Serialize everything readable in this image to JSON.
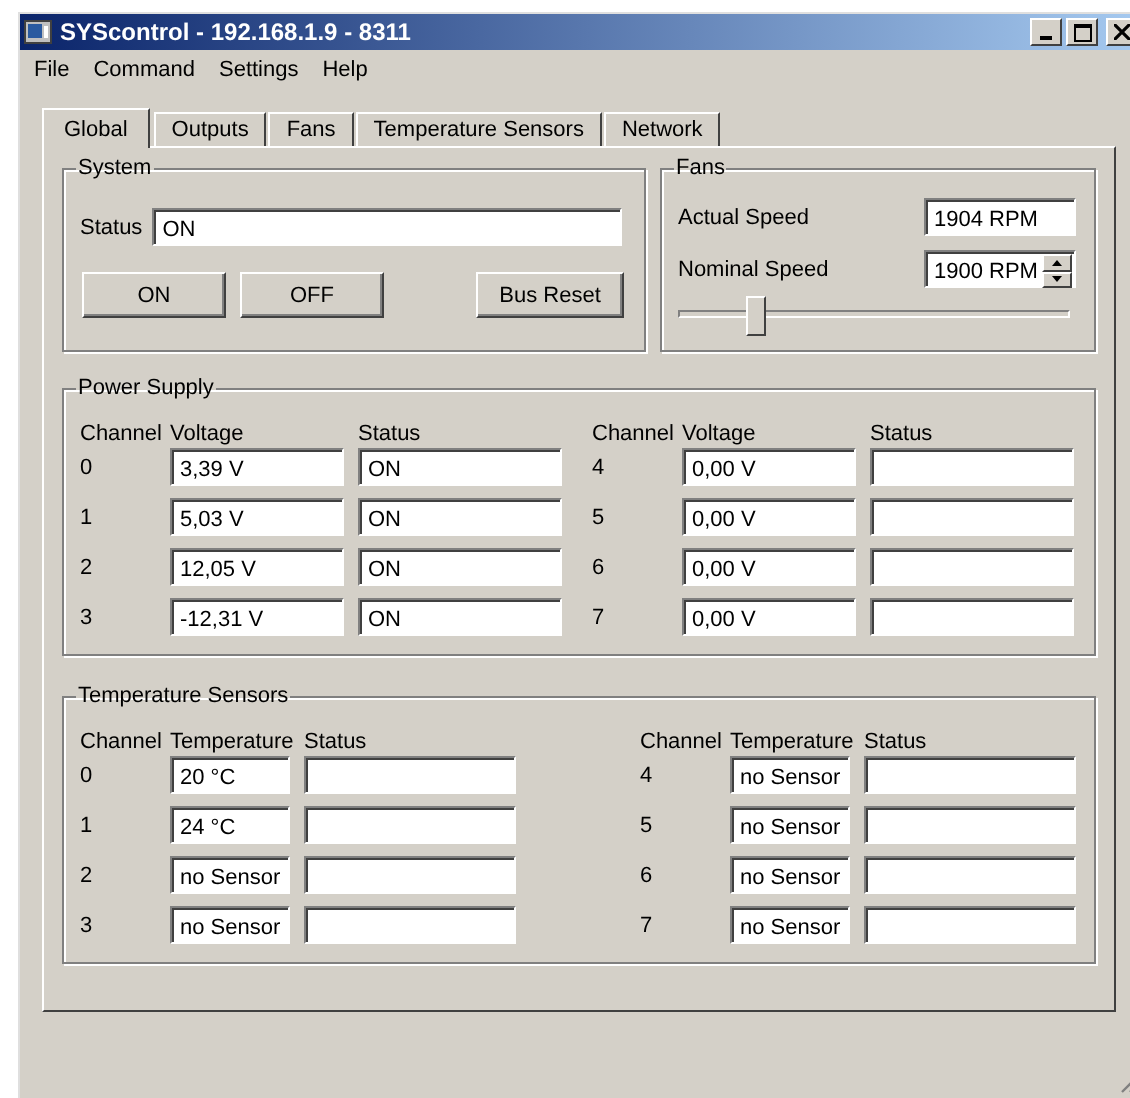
{
  "window": {
    "title": "SYScontrol - 192.168.1.9 - 8311"
  },
  "menu": [
    "File",
    "Command",
    "Settings",
    "Help"
  ],
  "tabs": [
    {
      "label": "Global",
      "selected": true
    },
    {
      "label": "Outputs",
      "selected": false
    },
    {
      "label": "Fans",
      "selected": false
    },
    {
      "label": "Temperature Sensors",
      "selected": false
    },
    {
      "label": "Network",
      "selected": false
    }
  ],
  "system": {
    "title": "System",
    "status_label": "Status",
    "status_value": "ON",
    "buttons": [
      "ON",
      "OFF",
      "Bus Reset"
    ]
  },
  "fans": {
    "title": "Fans",
    "actual_label": "Actual Speed",
    "actual_value": "1904 RPM",
    "nominal_label": "Nominal Speed",
    "nominal_value": "1900 RPM",
    "slider": {
      "level": 0.2
    }
  },
  "power_supply": {
    "title": "Power Supply",
    "halves": [
      {
        "columns": [
          "Channel",
          "Voltage",
          "Status"
        ],
        "rows": [
          {
            "channel": "0",
            "voltage": "3,39 V",
            "status": "ON"
          },
          {
            "channel": "1",
            "voltage": "5,03 V",
            "status": "ON"
          },
          {
            "channel": "2",
            "voltage": "12,05 V",
            "status": "ON"
          },
          {
            "channel": "3",
            "voltage": "-12,31 V",
            "status": "ON"
          }
        ]
      },
      {
        "columns": [
          "Channel",
          "Voltage",
          "Status"
        ],
        "rows": [
          {
            "channel": "4",
            "voltage": "0,00 V"
          },
          {
            "channel": "5",
            "voltage": "0,00 V"
          },
          {
            "channel": "6",
            "voltage": "0,00 V"
          },
          {
            "channel": "7",
            "voltage": "0,00 V"
          }
        ]
      }
    ]
  },
  "temperature_sensors": {
    "title": "Temperature Sensors",
    "halves": [
      {
        "columns": [
          "Channel",
          "Temperature",
          "Status"
        ],
        "rows": [
          {
            "channel": "0",
            "temperature": "20 °C"
          },
          {
            "channel": "1",
            "temperature": "24 °C"
          },
          {
            "channel": "2",
            "temperature": "no Sensor"
          },
          {
            "channel": "3",
            "temperature": "no Sensor"
          }
        ]
      },
      {
        "columns": [
          "Channel",
          "Temperature",
          "Status"
        ],
        "rows": [
          {
            "channel": "4",
            "temperature": "no Sensor"
          },
          {
            "channel": "5",
            "temperature": "no Sensor"
          },
          {
            "channel": "6",
            "temperature": "no Sensor"
          },
          {
            "channel": "7",
            "temperature": "no Sensor"
          }
        ]
      }
    ]
  }
}
